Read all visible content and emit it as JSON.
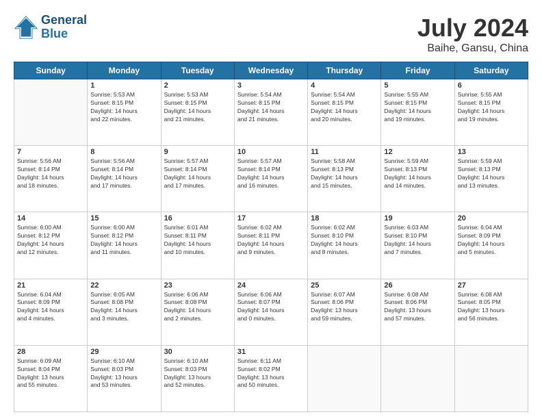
{
  "header": {
    "logo_line1": "General",
    "logo_line2": "Blue",
    "title": "July 2024",
    "subtitle": "Baihe, Gansu, China"
  },
  "weekdays": [
    "Sunday",
    "Monday",
    "Tuesday",
    "Wednesday",
    "Thursday",
    "Friday",
    "Saturday"
  ],
  "weeks": [
    [
      {
        "day": "",
        "empty": true
      },
      {
        "day": "1",
        "sunrise": "5:53 AM",
        "sunset": "8:15 PM",
        "daylight": "14 hours and 22 minutes."
      },
      {
        "day": "2",
        "sunrise": "5:53 AM",
        "sunset": "8:15 PM",
        "daylight": "14 hours and 21 minutes."
      },
      {
        "day": "3",
        "sunrise": "5:54 AM",
        "sunset": "8:15 PM",
        "daylight": "14 hours and 21 minutes."
      },
      {
        "day": "4",
        "sunrise": "5:54 AM",
        "sunset": "8:15 PM",
        "daylight": "14 hours and 20 minutes."
      },
      {
        "day": "5",
        "sunrise": "5:55 AM",
        "sunset": "8:15 PM",
        "daylight": "14 hours and 19 minutes."
      },
      {
        "day": "6",
        "sunrise": "5:55 AM",
        "sunset": "8:15 PM",
        "daylight": "14 hours and 19 minutes."
      }
    ],
    [
      {
        "day": "7",
        "sunrise": "5:56 AM",
        "sunset": "8:14 PM",
        "daylight": "14 hours and 18 minutes."
      },
      {
        "day": "8",
        "sunrise": "5:56 AM",
        "sunset": "8:14 PM",
        "daylight": "14 hours and 17 minutes."
      },
      {
        "day": "9",
        "sunrise": "5:57 AM",
        "sunset": "8:14 PM",
        "daylight": "14 hours and 17 minutes."
      },
      {
        "day": "10",
        "sunrise": "5:57 AM",
        "sunset": "8:14 PM",
        "daylight": "14 hours and 16 minutes."
      },
      {
        "day": "11",
        "sunrise": "5:58 AM",
        "sunset": "8:13 PM",
        "daylight": "14 hours and 15 minutes."
      },
      {
        "day": "12",
        "sunrise": "5:59 AM",
        "sunset": "8:13 PM",
        "daylight": "14 hours and 14 minutes."
      },
      {
        "day": "13",
        "sunrise": "5:59 AM",
        "sunset": "8:13 PM",
        "daylight": "14 hours and 13 minutes."
      }
    ],
    [
      {
        "day": "14",
        "sunrise": "6:00 AM",
        "sunset": "8:12 PM",
        "daylight": "14 hours and 12 minutes."
      },
      {
        "day": "15",
        "sunrise": "6:00 AM",
        "sunset": "8:12 PM",
        "daylight": "14 hours and 11 minutes."
      },
      {
        "day": "16",
        "sunrise": "6:01 AM",
        "sunset": "8:11 PM",
        "daylight": "14 hours and 10 minutes."
      },
      {
        "day": "17",
        "sunrise": "6:02 AM",
        "sunset": "8:11 PM",
        "daylight": "14 hours and 9 minutes."
      },
      {
        "day": "18",
        "sunrise": "6:02 AM",
        "sunset": "8:10 PM",
        "daylight": "14 hours and 8 minutes."
      },
      {
        "day": "19",
        "sunrise": "6:03 AM",
        "sunset": "8:10 PM",
        "daylight": "14 hours and 7 minutes."
      },
      {
        "day": "20",
        "sunrise": "6:04 AM",
        "sunset": "8:09 PM",
        "daylight": "14 hours and 5 minutes."
      }
    ],
    [
      {
        "day": "21",
        "sunrise": "6:04 AM",
        "sunset": "8:09 PM",
        "daylight": "14 hours and 4 minutes."
      },
      {
        "day": "22",
        "sunrise": "6:05 AM",
        "sunset": "8:08 PM",
        "daylight": "14 hours and 3 minutes."
      },
      {
        "day": "23",
        "sunrise": "6:06 AM",
        "sunset": "8:08 PM",
        "daylight": "14 hours and 2 minutes."
      },
      {
        "day": "24",
        "sunrise": "6:06 AM",
        "sunset": "8:07 PM",
        "daylight": "14 hours and 0 minutes."
      },
      {
        "day": "25",
        "sunrise": "6:07 AM",
        "sunset": "8:06 PM",
        "daylight": "13 hours and 59 minutes."
      },
      {
        "day": "26",
        "sunrise": "6:08 AM",
        "sunset": "8:06 PM",
        "daylight": "13 hours and 57 minutes."
      },
      {
        "day": "27",
        "sunrise": "6:08 AM",
        "sunset": "8:05 PM",
        "daylight": "13 hours and 56 minutes."
      }
    ],
    [
      {
        "day": "28",
        "sunrise": "6:09 AM",
        "sunset": "8:04 PM",
        "daylight": "13 hours and 55 minutes."
      },
      {
        "day": "29",
        "sunrise": "6:10 AM",
        "sunset": "8:03 PM",
        "daylight": "13 hours and 53 minutes."
      },
      {
        "day": "30",
        "sunrise": "6:10 AM",
        "sunset": "8:03 PM",
        "daylight": "13 hours and 52 minutes."
      },
      {
        "day": "31",
        "sunrise": "6:11 AM",
        "sunset": "8:02 PM",
        "daylight": "13 hours and 50 minutes."
      },
      {
        "day": "",
        "empty": true
      },
      {
        "day": "",
        "empty": true
      },
      {
        "day": "",
        "empty": true
      }
    ]
  ],
  "labels": {
    "sunrise": "Sunrise:",
    "sunset": "Sunset:",
    "daylight": "Daylight:"
  }
}
